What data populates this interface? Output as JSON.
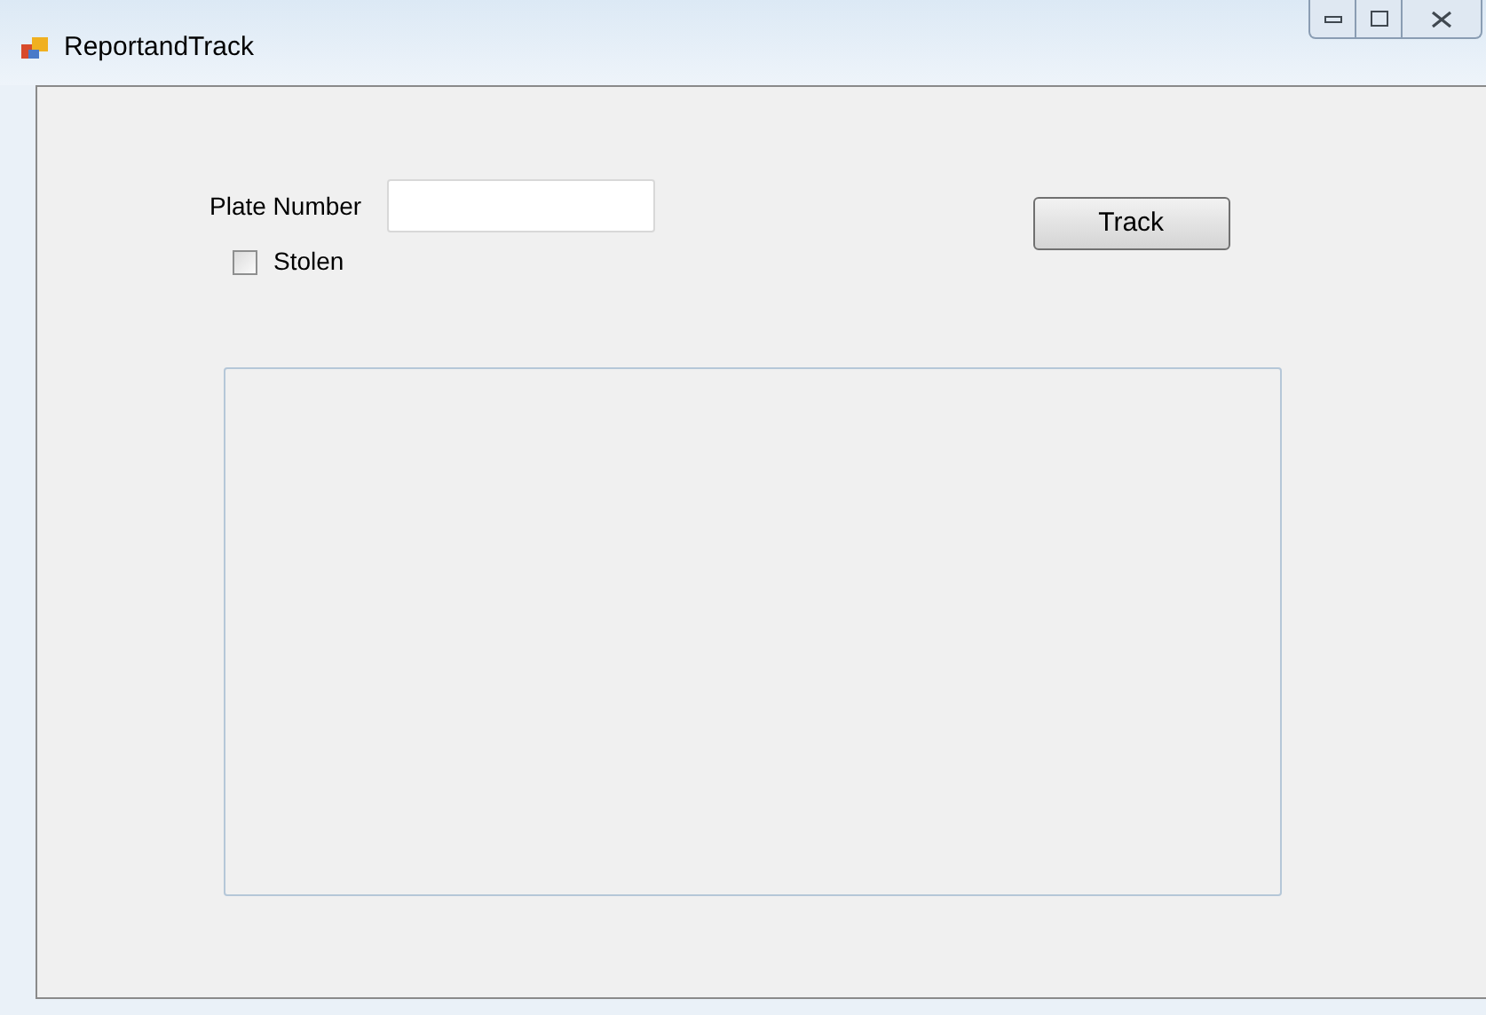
{
  "window": {
    "title": "ReportandTrack"
  },
  "form": {
    "plate_label": "Plate Number",
    "stolen": {
      "label": "Stolen",
      "checked": false
    },
    "track_button": "Track"
  }
}
